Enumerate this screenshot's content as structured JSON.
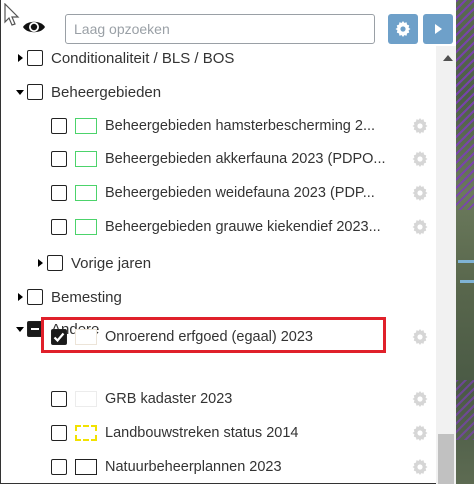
{
  "search": {
    "placeholder": "Laag opzoeken"
  },
  "header": {
    "eye_icon": "eye-icon",
    "settings_icon": "gear-icon",
    "play_icon": "play-icon"
  },
  "tree": [
    {
      "label": "Conditionaliteit / BLS / BOS",
      "level": 0,
      "expanded": false,
      "checked": false
    },
    {
      "label": "Beheergebieden",
      "level": 0,
      "expanded": true,
      "checked": false
    },
    {
      "label": "Beheergebieden hamsterbescherming 2...",
      "level": 1,
      "legend": "green-outline",
      "checked": false
    },
    {
      "label": "Beheergebieden akkerfauna 2023 (PDPO...",
      "level": 1,
      "legend": "green-outline",
      "checked": false
    },
    {
      "label": "Beheergebieden weidefauna 2023 (PDP...",
      "level": 1,
      "legend": "green-outline",
      "checked": false
    },
    {
      "label": "Beheergebieden grauwe kiekendief 2023...",
      "level": 1,
      "legend": "green-outline",
      "checked": false
    },
    {
      "label": "Vorige jaren",
      "level": 1,
      "expanded": false,
      "checked": false
    },
    {
      "label": "Bemesting",
      "level": 0,
      "expanded": false,
      "checked": false
    },
    {
      "label": "Andere",
      "level": 0,
      "expanded": true,
      "checked": "partial"
    },
    {
      "label": "Onroerend erfgoed (egaal) 2023",
      "level": 1,
      "legend": "beige-outline",
      "checked": true,
      "highlighted": true
    },
    {
      "label": "GRB kadaster 2023",
      "level": 1,
      "legend": "light-outline",
      "checked": false
    },
    {
      "label": "Landbouwstreken status 2014",
      "level": 1,
      "legend": "yellow-dashed",
      "checked": false
    },
    {
      "label": "Natuurbeheerplannen 2023",
      "level": 1,
      "legend": "black-outline",
      "checked": false
    }
  ],
  "colors": {
    "accent_button": "#6ea0c9",
    "highlight": "#e0202a",
    "legend_green": "#4cd36b",
    "legend_yellow": "#f2e200"
  }
}
